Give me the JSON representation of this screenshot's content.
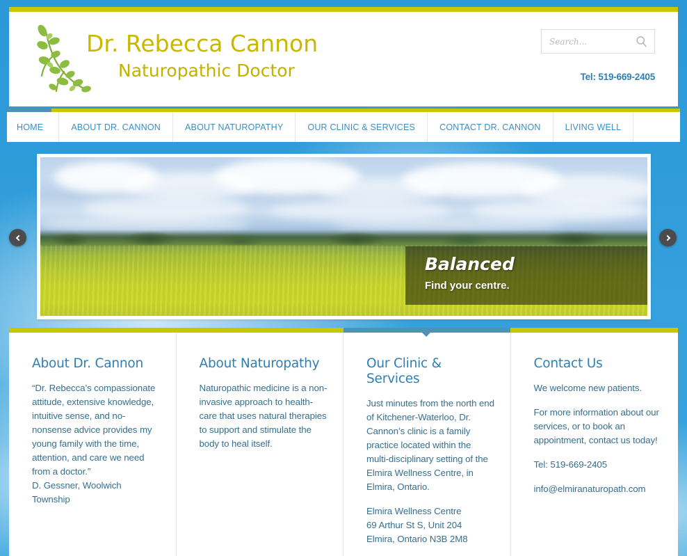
{
  "header": {
    "logo": {
      "icon": "vine-leaf-icon",
      "title": "Dr. Rebecca Cannon",
      "subtitle": "Naturopathic Doctor",
      "title_color": "#c9b800"
    },
    "search": {
      "placeholder": "Search...",
      "value": "",
      "icon": "search-icon"
    },
    "telephone": "Tel: 519-669-2405",
    "accent_yellow": "#c9c800",
    "accent_blue": "#3a8ec4"
  },
  "nav": {
    "active_index": 0,
    "items": [
      {
        "label": "HOME"
      },
      {
        "label": "ABOUT DR. CANNON"
      },
      {
        "label": "ABOUT NATUROPATHY"
      },
      {
        "label": "OUR CLINIC & SERVICES"
      },
      {
        "label": "CONTACT DR. CANNON"
      },
      {
        "label": "LIVING WELL"
      }
    ]
  },
  "slider": {
    "prev_icon": "chevron-left-icon",
    "next_icon": "chevron-right-icon",
    "caption": {
      "title": "Balanced",
      "subtitle": "Find your centre."
    },
    "image_alt": "Canola field with blue sky and clouds"
  },
  "content": {
    "active_column_index": 2,
    "columns": [
      {
        "heading": "About Dr. Cannon",
        "paragraphs": [
          "“Dr. Rebecca’s compassionate attitude, extensive knowledge, intuitive sense, and no-nonsense advice provides my young family with the time, attention, and care we need from a doctor.”",
          "D. Gessner, Woolwich Township"
        ]
      },
      {
        "heading": "About Naturopathy",
        "paragraphs": [
          "Naturopathic medicine is a non-invasive approach to health-care that uses natural therapies to support and stimulate the body to heal itself."
        ]
      },
      {
        "heading": "Our Clinic & Services",
        "paragraphs": [
          "Just minutes from the north end of Kitchener-Waterloo, Dr. Cannon’s clinic is a family practice located within the multi-disciplinary setting of the Elmira Wellness Centre, in Elmira, Ontario.",
          "Elmira Wellness Centre",
          "69 Arthur St S, Unit 204",
          "Elmira, Ontario N3B 2M8"
        ]
      },
      {
        "heading": "Contact Us",
        "paragraphs": [
          "We welcome new patients.",
          "For more information about our services, or to book an appointment, contact us today!",
          "Tel: 519-669-2405",
          "info@elmiranaturopath.com"
        ]
      }
    ]
  }
}
